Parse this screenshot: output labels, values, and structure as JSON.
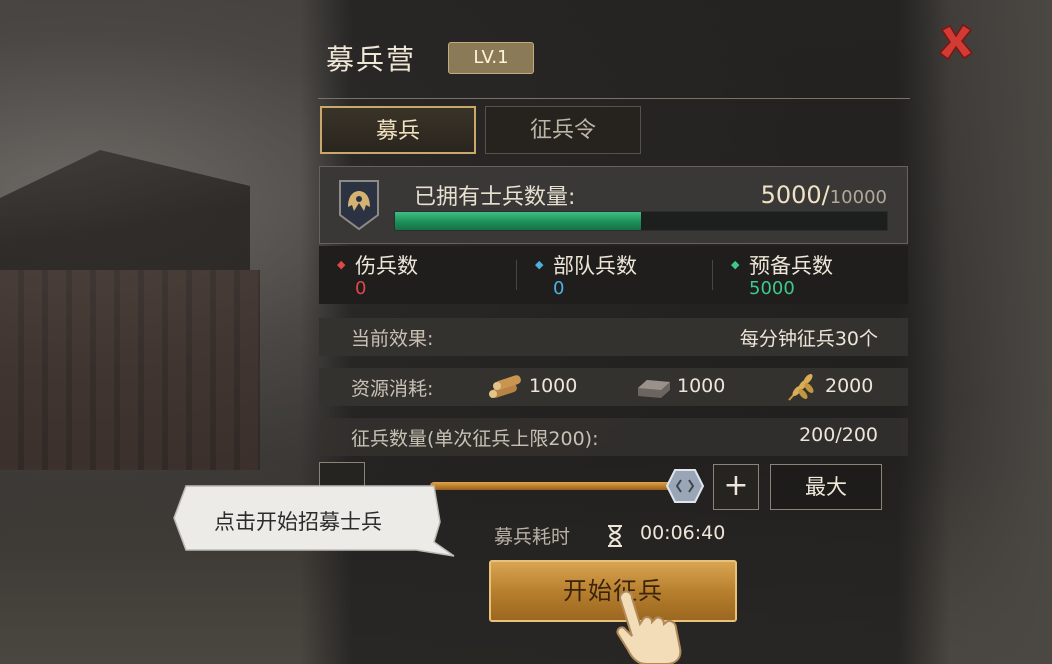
{
  "header": {
    "title": "募兵营",
    "level": "LV.1"
  },
  "tabs": [
    {
      "label": "募兵",
      "active": true
    },
    {
      "label": "征兵令",
      "active": false
    }
  ],
  "soldiers": {
    "label": "已拥有士兵数量:",
    "current": "5000/",
    "capacity": "10000",
    "progress_fraction": 0.5
  },
  "stats": [
    {
      "label": "伤兵数",
      "value": "0",
      "color": "#e04848"
    },
    {
      "label": "部队兵数",
      "value": "0",
      "color": "#4fb0e0"
    },
    {
      "label": "预备兵数",
      "value": "5000",
      "color": "#3ec98a"
    }
  ],
  "effect": {
    "label": "当前效果:",
    "value": "每分钟征兵30个"
  },
  "resources": {
    "label": "资源消耗:",
    "items": [
      {
        "icon": "wood-icon",
        "amount": "1000"
      },
      {
        "icon": "iron-icon",
        "amount": "1000"
      },
      {
        "icon": "grain-icon",
        "amount": "2000"
      }
    ]
  },
  "recruit_count": {
    "label": "征兵数量(单次征兵上限200):",
    "value": "200/200",
    "slider_fraction": 1.0
  },
  "controls": {
    "plus": "+",
    "max": "最大"
  },
  "tooltip": "点击开始招募士兵",
  "duration": {
    "label": "募兵耗时",
    "value": "00:06:40"
  },
  "start_button": "开始征兵",
  "colors": {
    "gold": "#c9a86a",
    "progress": "#2aa86a",
    "slider": "#d0963e"
  }
}
